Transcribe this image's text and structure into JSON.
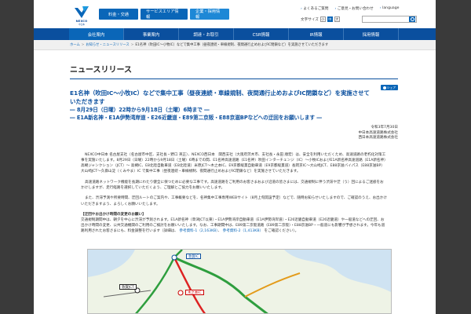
{
  "header": {
    "logo_text": "NEXCO",
    "logo_sub": "中日本",
    "nav": [
      "料金・交通",
      "サービスエリア情報",
      "企業・採用情報"
    ],
    "util_links": [
      "よくあるご質問",
      "ご意見・お問い合わせ",
      "language"
    ],
    "font_size_label": "文字サイズ",
    "font_small": "小",
    "font_medium": "中",
    "font_large": "大"
  },
  "mainnav": [
    "会社案内",
    "事業案内",
    "調達・お取引",
    "CSR情報",
    "IR情報",
    "採用情報"
  ],
  "breadcrumb": {
    "home": "ホーム",
    "news": "お知らせ・ニュースリリース",
    "current": "E1名神（吹田IC〜小牧IC）などで集中工事（昼夜連続・車線規制、夜間通行止めおよびIC閉鎖など）を実施させていただきます"
  },
  "page_title": "ニュースリリース",
  "share_label": "シェア",
  "headline": {
    "line1": "E1名神（吹田IC〜小牧IC）などで集中工事（昼夜連続・車線規制、夜間通行止めおよびIC閉鎖など）を実施させて",
    "line2": "いただきます",
    "line3": "― 8月29日（日曜）22時から9月18日（土曜）6時まで ―",
    "line4": "― E1A新名神・E1A伊勢湾岸道・E26近畿道・E89第二京阪・E88京滋BPなどへの迂回をお願いします ―"
  },
  "date_block": {
    "date": "令和3年7月30日",
    "org1": "中日本高速道路株式会社",
    "org2": "西日本高速道路株式会社"
  },
  "body": {
    "p1": "NEXCO中日本 名古屋支社（名古屋市中区、支社長・野口 英正）、NEXCO西日本　関西支社（大阪府茨木市、支社長・永田 順宏）は、安全を利用いただくため、高速道路の老朽化対策工事を実施いたします。8月29日（日曜）22時から9月18日（土曜）6時までの間、E1名神高速道路（E1名神）吹田インターチェンジ（IC）〜小牧ICおよびE1A新名神高速道路（E1A新名神）高槻ジャンクション（JCT）〜 高槻IC、E8北陸自動車道（E8北陸道）米原JCT〜木之本IC、E9京都縦貫自動車道（E9京都縦貫道）長岡京IC〜大山崎JCT、E88京滋バイパス（E88京滋BP）大山崎JCT〜久御山淀（くみやま）IC で集中工事（昼夜連続・車線規制、夜間通行止めおよびIC閉鎖など）を実施させていただきます。",
    "p2": "高速道路ネットワーク機能を長期にわたり健全に保つために必要な工事です。高速道路をご利用のお客さまおよび沿道の皆さまには、交通規制に伴う渋滞や迂（う）回によるご迷惑をおかけしますが、走行経路を選択していただくよう、ご理解とご協力をお願いいたします。",
    "p3": "また、渋滞予測や所要時間、迂回ルートのご案内や、工事概要などを、名神集中工事専用WEBサイト（8月上旬開設予定）などで、随時お知らせいたしますので、ご確認のうえ、お出かけいただきますよう、よろしくお願いいたします。"
  },
  "notice": {
    "title": "【迂回やお出かけ時間の変更のお願い】",
    "text": "交通規制期間中は、朝夕を中心に渋滞が予測されます。E1A新名神（草津JCT以東）・E1A伊勢湾岸自動車道（E1A伊勢湾岸道）・E26近畿自動車道（E26近畿道）や一般道などへの迂回、お出かけ時間の変更、公共交通機関のご利用のご検討をお願いいたします。なお、工事期間中は、E89第二京阪道路（E89第二京阪）・E88京滋BP・一般道にも影響が予想されます。今年も道路利用されたお客さまにも、料金調整を行います（詳細は、",
    "link1": "参考資料-1（2,163KB）",
    "link2": "参考資料-2（1,413KB）",
    "tail": "をご確認ください）。"
  },
  "map": {
    "labels": [
      "敦賀IC",
      "敦賀JCT",
      "木之本IC"
    ]
  }
}
